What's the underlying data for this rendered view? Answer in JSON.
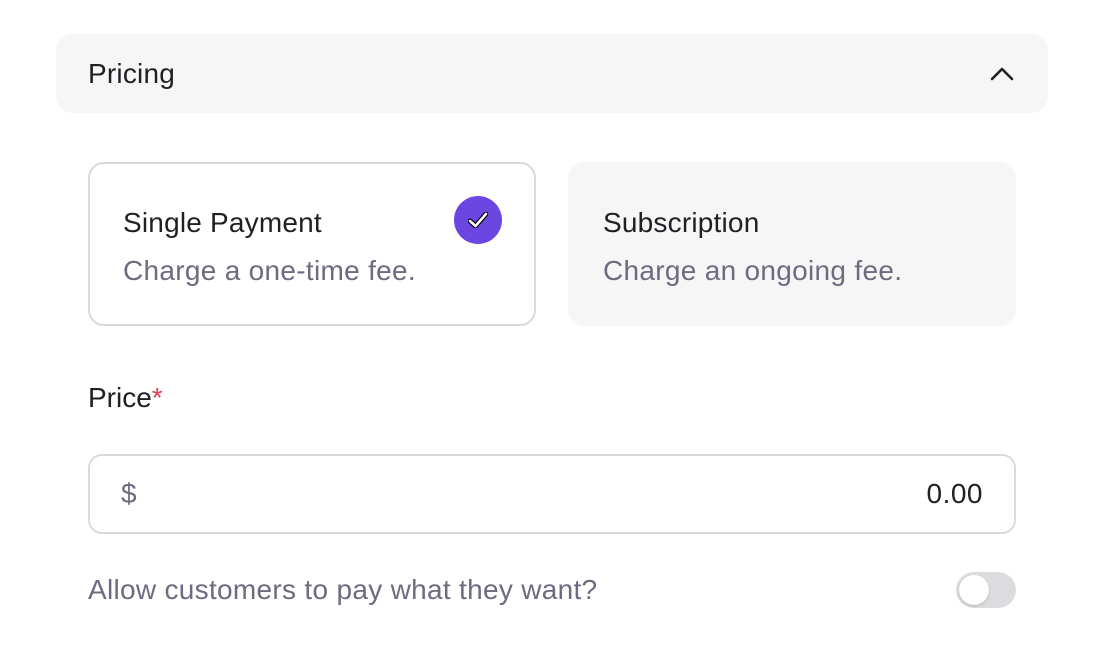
{
  "section": {
    "title": "Pricing",
    "collapse_icon": "chevron-up-icon"
  },
  "payment_options": [
    {
      "title": "Single Payment",
      "description": "Charge a one-time fee.",
      "selected": true,
      "indicator_icon": "check-circle-icon"
    },
    {
      "title": "Subscription",
      "description": "Charge an ongoing fee.",
      "selected": false
    }
  ],
  "price": {
    "label": "Price",
    "required_marker": "*",
    "currency_symbol": "$",
    "value": "0.00"
  },
  "pay_what_you_want": {
    "label": "Allow customers to pay what they want?",
    "enabled": false
  },
  "colors": {
    "accent": "#6b46e0",
    "required": "#e23b53",
    "muted_text": "#6c6b80",
    "panel_bg": "#f6f6f7",
    "border": "#dadadd"
  }
}
